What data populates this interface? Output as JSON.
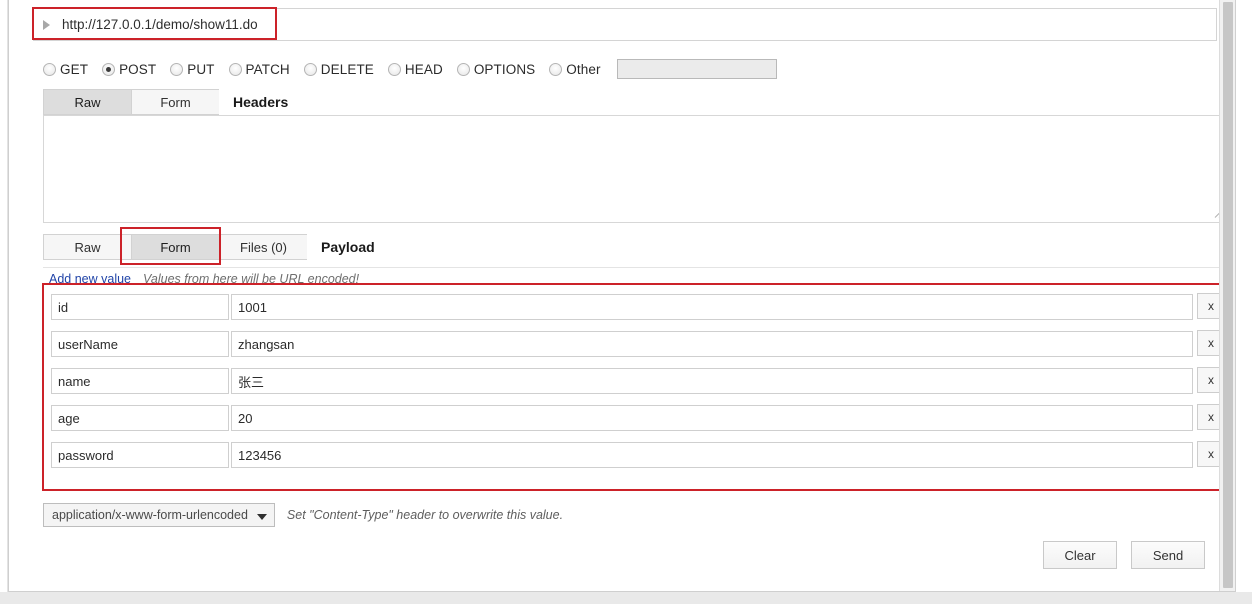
{
  "url_bar": {
    "disclosure_icon": "triangle-right-icon",
    "value": "http://127.0.0.1/demo/show11.do",
    "placeholder": "http://"
  },
  "methods": {
    "selected": "POST",
    "items": [
      {
        "label": "GET",
        "checked": false
      },
      {
        "label": "POST",
        "checked": true
      },
      {
        "label": "PUT",
        "checked": false
      },
      {
        "label": "PATCH",
        "checked": false
      },
      {
        "label": "DELETE",
        "checked": false
      },
      {
        "label": "HEAD",
        "checked": false
      },
      {
        "label": "OPTIONS",
        "checked": false
      },
      {
        "label": "Other",
        "checked": false
      }
    ],
    "other_value": "",
    "other_placeholder": ""
  },
  "headers_section": {
    "title": "Headers",
    "tabs": [
      {
        "label": "Raw",
        "active": true
      },
      {
        "label": "Form",
        "active": false
      }
    ],
    "textarea_value": "",
    "textarea_placeholder": ""
  },
  "payload_section": {
    "title": "Payload",
    "tabs": [
      {
        "label": "Raw",
        "active": false
      },
      {
        "label": "Form",
        "active": true
      },
      {
        "label": "Files (0)",
        "active": false
      }
    ],
    "add_new_value_link": "Add new value",
    "hint": "Values from here will be URL encoded!",
    "rows": [
      {
        "key": "id",
        "value": "1001",
        "remove_label": "x"
      },
      {
        "key": "userName",
        "value": "zhangsan",
        "remove_label": "x"
      },
      {
        "key": "name",
        "value": "张三",
        "remove_label": "x"
      },
      {
        "key": "age",
        "value": "20",
        "remove_label": "x"
      },
      {
        "key": "password",
        "value": "123456",
        "remove_label": "x"
      }
    ]
  },
  "content_type": {
    "selected": "application/x-www-form-urlencoded",
    "caret_icon": "chevron-down-icon",
    "note": "Set \"Content-Type\" header to overwrite this value."
  },
  "actions": {
    "clear_label": "Clear",
    "send_label": "Send"
  },
  "annotations": {
    "color": "#cc2229",
    "targets": [
      "url-field",
      "payload-form-tab",
      "form-rows-area"
    ]
  },
  "colors": {
    "link": "#2144a8",
    "annotation": "#cc2229",
    "tab_active_bg": "#dddddd",
    "tab_bg": "#f6f6f6",
    "page_bg": "#ffffff"
  }
}
